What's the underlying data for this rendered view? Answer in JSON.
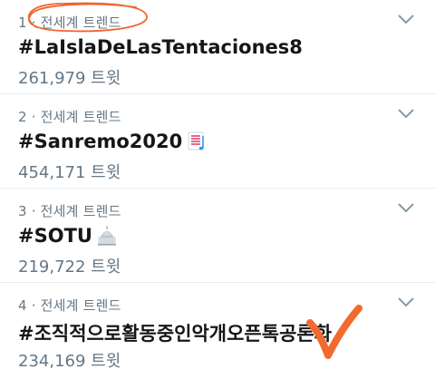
{
  "trends": [
    {
      "meta": "1 · 전세계 트렌드",
      "title": "#LaIslaDeLasTentaciones8",
      "tweets": "261,979 트윗",
      "emoji": ""
    },
    {
      "meta": "2 · 전세계 트렌드",
      "title": "#Sanremo2020",
      "tweets": "454,171 트윗",
      "emoji": "music-score-icon"
    },
    {
      "meta": "3 · 전세계 트렌드",
      "title": "#SOTU",
      "tweets": "219,722 트윗",
      "emoji": "capitol-building-icon"
    },
    {
      "meta": "4 · 전세계 트렌드",
      "title": "#조직적으로활동중인악개오픈톡공론화",
      "tweets": "234,169 트윗",
      "emoji": ""
    }
  ],
  "colors": {
    "text_primary": "#14171a",
    "text_secondary": "#657786",
    "divider": "#e6ecf0",
    "annotation": "#f0642e"
  }
}
